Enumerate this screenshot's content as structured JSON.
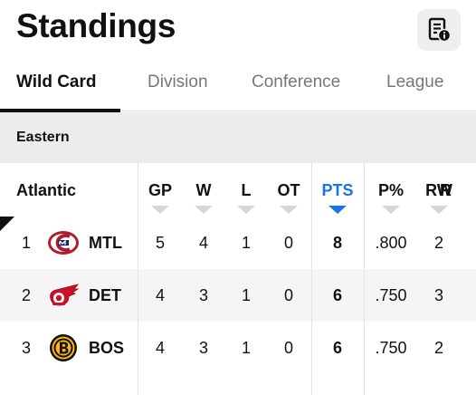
{
  "header": {
    "title": "Standings",
    "info_icon": "document-info-icon"
  },
  "tabs": [
    {
      "label": "Wild Card",
      "active": true
    },
    {
      "label": "Division",
      "active": false
    },
    {
      "label": "Conference",
      "active": false
    },
    {
      "label": "League",
      "active": false
    }
  ],
  "section": {
    "label": "Eastern"
  },
  "table": {
    "group_label": "Atlantic",
    "columns": [
      "GP",
      "W",
      "L",
      "OT",
      "PTS",
      "P%",
      "RW",
      "R"
    ],
    "sort_column": "PTS",
    "rows": [
      {
        "rank": "1",
        "team": "MTL",
        "logo": "canadiens-logo",
        "gp": "5",
        "w": "4",
        "l": "1",
        "ot": "0",
        "pts": "8",
        "pct": ".800",
        "rw": "2"
      },
      {
        "rank": "2",
        "team": "DET",
        "logo": "red-wings-logo",
        "gp": "4",
        "w": "3",
        "l": "1",
        "ot": "0",
        "pts": "6",
        "pct": ".750",
        "rw": "3"
      },
      {
        "rank": "3",
        "team": "BOS",
        "logo": "bruins-logo",
        "gp": "4",
        "w": "3",
        "l": "1",
        "ot": "0",
        "pts": "6",
        "pct": ".750",
        "rw": "2"
      }
    ]
  },
  "colors": {
    "accent": "#1a73e8",
    "section_bg": "#ececec",
    "row_alt_bg": "#f5f5f5"
  }
}
